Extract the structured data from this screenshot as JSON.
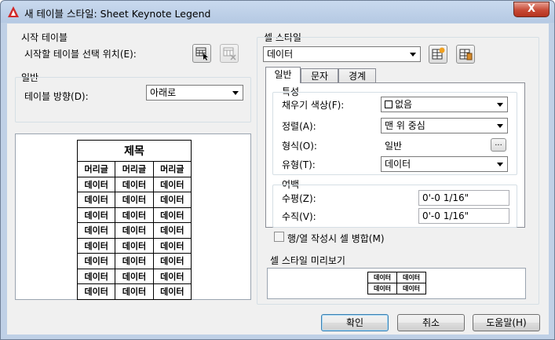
{
  "window": {
    "title": "새 테이블 스타일: Sheet Keynote Legend",
    "close_label": "X"
  },
  "starting_table": {
    "group_label": "시작 테이블",
    "select_label": "시작할 테이블 선택 위치(E):"
  },
  "general": {
    "group_label": "일반",
    "direction_label": "테이블 방향(D):",
    "direction_value": "아래로"
  },
  "left_preview": {
    "title": "제목",
    "headers": [
      "머리글",
      "머리글",
      "머리글"
    ],
    "rows": [
      [
        "데이터",
        "데이터",
        "데이터"
      ],
      [
        "데이터",
        "데이터",
        "데이터"
      ],
      [
        "데이터",
        "데이터",
        "데이터"
      ],
      [
        "데이터",
        "데이터",
        "데이터"
      ],
      [
        "데이터",
        "데이터",
        "데이터"
      ],
      [
        "데이터",
        "데이터",
        "데이터"
      ],
      [
        "데이터",
        "데이터",
        "데이터"
      ],
      [
        "데이터",
        "데이터",
        "데이터"
      ]
    ]
  },
  "cell_style": {
    "group_label": "셀 스타일",
    "selected": "데이터",
    "tabs": [
      {
        "label": "일반"
      },
      {
        "label": "문자"
      },
      {
        "label": "경계"
      }
    ],
    "properties": {
      "section_label": "특성",
      "fill_color_label": "채우기 색상(F):",
      "fill_color_value": "없음",
      "alignment_label": "정렬(A):",
      "alignment_value": "맨 위 중심",
      "format_label": "형식(O):",
      "format_value": "일반",
      "format_button": "...",
      "type_label": "유형(T):",
      "type_value": "데이터"
    },
    "margins": {
      "section_label": "여백",
      "horizontal_label": "수평(Z):",
      "horizontal_value": "0'-0 1/16\"",
      "vertical_label": "수직(V):",
      "vertical_value": "0'-0 1/16\""
    },
    "merge_label": "행/열 작성시 셀 병합(M)"
  },
  "cell_preview": {
    "group_label": "셀 스타일 미리보기",
    "rows": [
      [
        "데이터",
        "데이터"
      ],
      [
        "데이터",
        "데이터"
      ]
    ]
  },
  "buttons": {
    "ok": "확인",
    "cancel": "취소",
    "help": "도움말(H)"
  },
  "colors": {
    "title_bar": "#bfd0e6",
    "dialog_bg": "#f0f0f0",
    "close_button": "#c74a36",
    "autocad_red": "#d12a2a"
  }
}
